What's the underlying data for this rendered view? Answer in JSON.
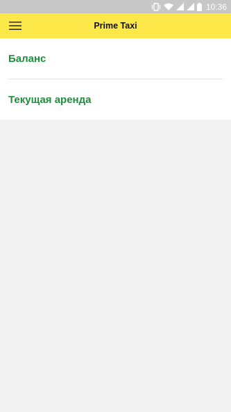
{
  "status_bar": {
    "time": "10:36",
    "icons": [
      "vibrate-icon",
      "wifi-icon",
      "signal-icon",
      "signal-icon",
      "battery-icon"
    ]
  },
  "app_bar": {
    "title": "Prime Taxi",
    "menu_icon": "hamburger-menu-icon"
  },
  "menu": {
    "items": [
      {
        "label": "Баланс"
      },
      {
        "label": "Текущая аренда"
      }
    ]
  },
  "colors": {
    "app_bar_bg": "#fde84a",
    "item_text": "#1e8f3a",
    "page_bg": "#f2f2f2",
    "status_bar_bg": "#c7c7c7"
  }
}
